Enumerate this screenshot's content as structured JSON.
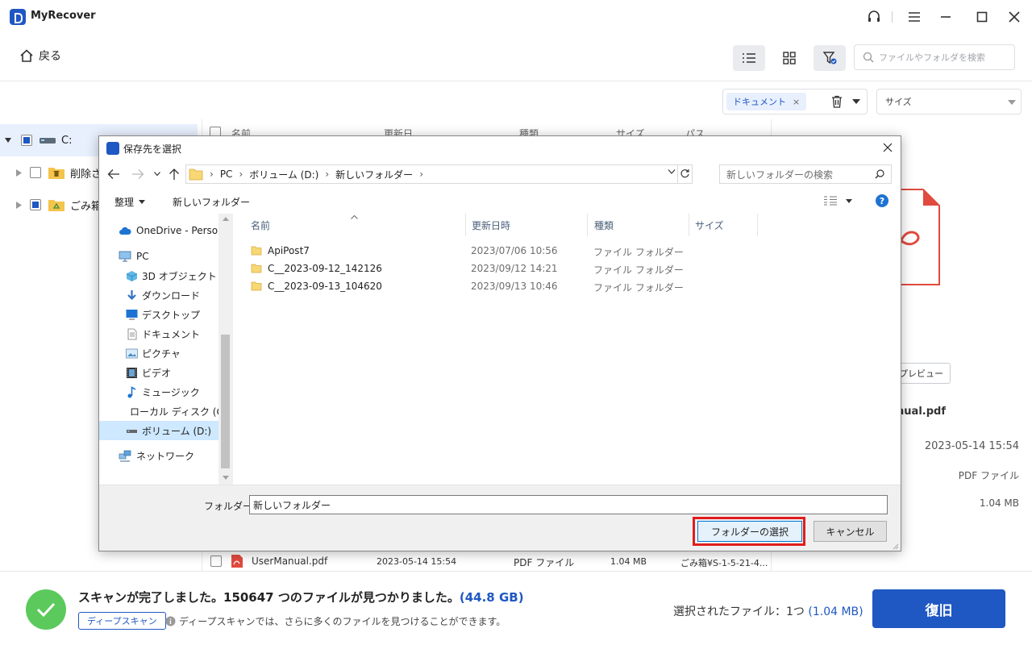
{
  "app": {
    "title": "MyRecover"
  },
  "toolbar": {
    "back_label": "戻る",
    "search_placeholder": "ファイルやフォルダを検索"
  },
  "filter": {
    "type_tag": "ドキュメント",
    "size_label": "サイズ"
  },
  "tree": {
    "items": [
      {
        "label": "C:"
      },
      {
        "label": "削除さ"
      },
      {
        "label": "ごみ箱"
      }
    ]
  },
  "main": {
    "column_headers": [
      "名前",
      "更新日",
      "種類",
      "サイズ",
      "パス"
    ],
    "visible_row": {
      "name": "UserManual.pdf",
      "date": "2023-05-14 15:54",
      "type": "PDF ファイル",
      "size": "1.04 MB",
      "path": "ごみ箱¥S-1-5-21-4..."
    }
  },
  "preview": {
    "button_label": "プレビュー",
    "file_name": "UserManual.pdf",
    "date": "2023-05-14 15:54",
    "type": "PDF ファイル",
    "size": "1.04 MB"
  },
  "bottom": {
    "scan_message": "スキャンが完了しました。150647 つのファイルが見つかりました。",
    "scan_size": "(44.8 GB)",
    "deep_scan_button": "ディープスキャン",
    "deep_scan_note": "ディープスキャンでは、さらに多くのファイルを見つけることができます。",
    "selected_label": "選択されたファイル：1つ",
    "selected_size": "(1.04 MB)",
    "recover_button": "復旧"
  },
  "dialog": {
    "title": "保存先を選択",
    "breadcrumb": [
      "PC",
      "ボリューム (D:)",
      "新しいフォルダー"
    ],
    "search_placeholder": "新しいフォルダーの検索",
    "organize_label": "整理",
    "new_folder_label": "新しいフォルダー",
    "nav_items": [
      {
        "label": "OneDrive - Perso"
      },
      {
        "label": "PC"
      },
      {
        "label": "3D オブジェクト"
      },
      {
        "label": "ダウンロード"
      },
      {
        "label": "デスクトップ"
      },
      {
        "label": "ドキュメント"
      },
      {
        "label": "ピクチャ"
      },
      {
        "label": "ビデオ"
      },
      {
        "label": "ミュージック"
      },
      {
        "label": "ローカル ディスク (C"
      },
      {
        "label": "ボリューム (D:)"
      },
      {
        "label": "ネットワーク"
      }
    ],
    "columns": [
      "名前",
      "更新日時",
      "種類",
      "サイズ"
    ],
    "files": [
      {
        "name": "ApiPost7",
        "date": "2023/07/06 10:56",
        "type": "ファイル フォルダー"
      },
      {
        "name": "C__2023-09-12_142126",
        "date": "2023/09/12 14:21",
        "type": "ファイル フォルダー"
      },
      {
        "name": "C__2023-09-13_104620",
        "date": "2023/09/13 10:46",
        "type": "ファイル フォルダー"
      }
    ],
    "folder_label": "フォルダー:",
    "folder_value": "新しいフォルダー",
    "select_button": "フォルダーの選択",
    "cancel_button": "キャンセル"
  },
  "colors": {
    "accent": "#1f57c3",
    "success": "#5cc95c",
    "highlight": "#e11d1d",
    "pdf": "#e04a3f"
  }
}
